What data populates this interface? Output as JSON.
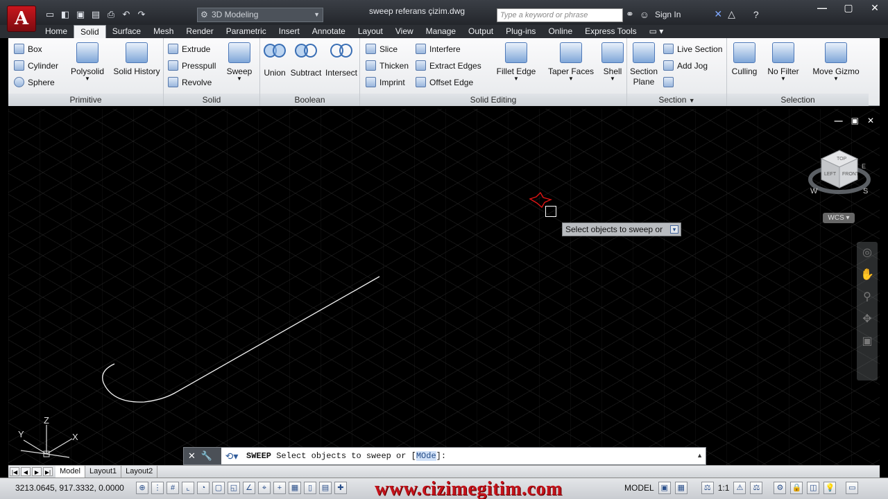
{
  "app": {
    "logo_letter": "A",
    "workspace": "3D Modeling",
    "document_title": "sweep referans çizim.dwg",
    "search_placeholder": "Type a keyword or phrase",
    "sign_in": "Sign In",
    "window_controls": [
      "—",
      "▢",
      "✕"
    ]
  },
  "qat": {
    "icons": [
      "new-icon",
      "open-icon",
      "save-icon",
      "save-as-icon",
      "print-icon",
      "undo-icon",
      "redo-icon"
    ]
  },
  "tabs": [
    "Home",
    "Solid",
    "Surface",
    "Mesh",
    "Render",
    "Parametric",
    "Insert",
    "Annotate",
    "Layout",
    "View",
    "Manage",
    "Output",
    "Plug-ins",
    "Online",
    "Express Tools"
  ],
  "active_tab": "Solid",
  "ribbon": {
    "primitive": {
      "title": "Primitive",
      "small": [
        "Box",
        "Cylinder",
        "Sphere"
      ],
      "big": [
        "Polysolid",
        "Solid History"
      ]
    },
    "solid": {
      "title": "Solid",
      "small": [
        "Extrude",
        "Presspull",
        "Revolve"
      ],
      "big": [
        "Sweep"
      ]
    },
    "boolean": {
      "title": "Boolean",
      "big": [
        "Union",
        "Subtract",
        "Intersect"
      ]
    },
    "solid_editing": {
      "title": "Solid Editing",
      "small_a": [
        "Slice",
        "Thicken",
        "Imprint"
      ],
      "small_b": [
        "Interfere",
        "Extract Edges",
        "Offset Edge"
      ],
      "big": [
        "Fillet Edge",
        "Taper Faces",
        "Shell"
      ]
    },
    "section": {
      "title": "Section",
      "big": [
        "Section Plane"
      ],
      "small": [
        "Live Section",
        "Add Jog"
      ]
    },
    "selection": {
      "title": "Selection",
      "big": [
        "Culling",
        "No Filter",
        "Move Gizmo"
      ]
    }
  },
  "drawing": {
    "controls": [
      "—",
      "▣",
      "✕"
    ],
    "viewcube": {
      "top": "TOP",
      "left": "LEFT",
      "front": "FRONT",
      "compass": [
        "W",
        "S",
        "E"
      ]
    },
    "wcs": "WCS",
    "tooltip": "Select objects to sweep or",
    "ucs": {
      "x": "X",
      "y": "Y",
      "z": "Z"
    }
  },
  "command": {
    "name": "SWEEP",
    "prompt": "Select objects to sweep or [",
    "option": "MOde",
    "suffix": "]:"
  },
  "layouts": [
    "Model",
    "Layout1",
    "Layout2"
  ],
  "status": {
    "coords": "3213.0645, 917.3332, 0.0000",
    "watermark": "www.cizimegitim.com",
    "model": "MODEL",
    "scale": "1:1"
  }
}
